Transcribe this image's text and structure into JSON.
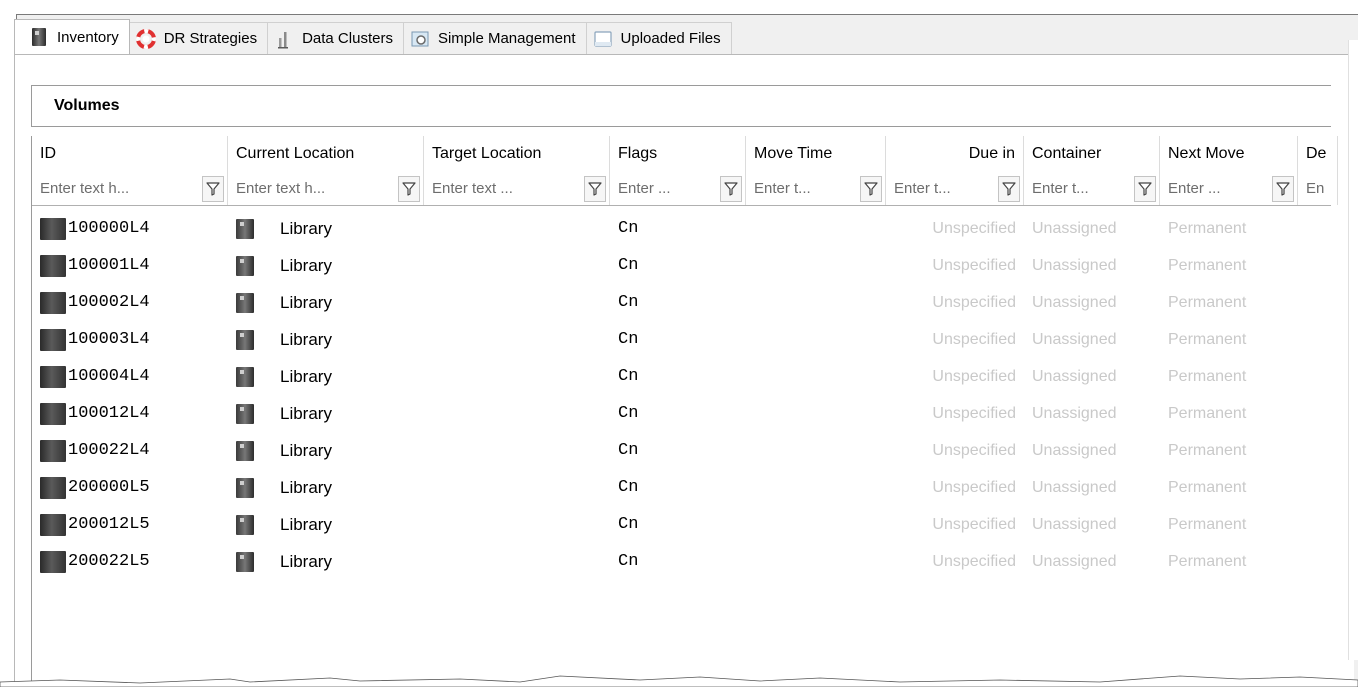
{
  "tabs": [
    {
      "label": "Inventory",
      "icon": "volume-icon",
      "active": true
    },
    {
      "label": "DR Strategies",
      "icon": "lifebuoy-icon",
      "active": false
    },
    {
      "label": "Data Clusters",
      "icon": "data-clusters-icon",
      "active": false
    },
    {
      "label": "Simple Management",
      "icon": "simple-management-icon",
      "active": false
    },
    {
      "label": "Uploaded Files",
      "icon": "uploaded-files-icon",
      "active": false
    }
  ],
  "group": {
    "title": "Volumes"
  },
  "grid": {
    "columns": [
      {
        "label": "ID",
        "filter_placeholder": "Enter text h..."
      },
      {
        "label": "Current Location",
        "filter_placeholder": "Enter text h..."
      },
      {
        "label": "Target Location",
        "filter_placeholder": "Enter text ..."
      },
      {
        "label": "Flags",
        "filter_placeholder": "Enter ..."
      },
      {
        "label": "Move Time",
        "filter_placeholder": "Enter t..."
      },
      {
        "label": "Due in",
        "filter_placeholder": "Enter t..."
      },
      {
        "label": "Container",
        "filter_placeholder": "Enter t..."
      },
      {
        "label": "Next Move",
        "filter_placeholder": "Enter ..."
      },
      {
        "label": "De",
        "filter_placeholder": "En"
      }
    ],
    "rows": [
      {
        "id": "100000L4",
        "current_location": "Library",
        "target_location": "",
        "flags": "Cn",
        "move_time": "",
        "due_in": "Unspecified",
        "container": "Unassigned",
        "next_move": "Permanent"
      },
      {
        "id": "100001L4",
        "current_location": "Library",
        "target_location": "",
        "flags": "Cn",
        "move_time": "",
        "due_in": "Unspecified",
        "container": "Unassigned",
        "next_move": "Permanent"
      },
      {
        "id": "100002L4",
        "current_location": "Library",
        "target_location": "",
        "flags": "Cn",
        "move_time": "",
        "due_in": "Unspecified",
        "container": "Unassigned",
        "next_move": "Permanent"
      },
      {
        "id": "100003L4",
        "current_location": "Library",
        "target_location": "",
        "flags": "Cn",
        "move_time": "",
        "due_in": "Unspecified",
        "container": "Unassigned",
        "next_move": "Permanent"
      },
      {
        "id": "100004L4",
        "current_location": "Library",
        "target_location": "",
        "flags": "Cn",
        "move_time": "",
        "due_in": "Unspecified",
        "container": "Unassigned",
        "next_move": "Permanent"
      },
      {
        "id": "100012L4",
        "current_location": "Library",
        "target_location": "",
        "flags": "Cn",
        "move_time": "",
        "due_in": "Unspecified",
        "container": "Unassigned",
        "next_move": "Permanent"
      },
      {
        "id": "100022L4",
        "current_location": "Library",
        "target_location": "",
        "flags": "Cn",
        "move_time": "",
        "due_in": "Unspecified",
        "container": "Unassigned",
        "next_move": "Permanent"
      },
      {
        "id": "200000L5",
        "current_location": "Library",
        "target_location": "",
        "flags": "Cn",
        "move_time": "",
        "due_in": "Unspecified",
        "container": "Unassigned",
        "next_move": "Permanent"
      },
      {
        "id": "200012L5",
        "current_location": "Library",
        "target_location": "",
        "flags": "Cn",
        "move_time": "",
        "due_in": "Unspecified",
        "container": "Unassigned",
        "next_move": "Permanent"
      },
      {
        "id": "200022L5",
        "current_location": "Library",
        "target_location": "",
        "flags": "Cn",
        "move_time": "",
        "due_in": "Unspecified",
        "container": "Unassigned",
        "next_move": "Permanent"
      }
    ]
  },
  "colors": {
    "faded_text": "#c9c9c9",
    "placeholder_text": "#6d6d6d",
    "lifebuoy_red": "#e03030",
    "border": "#9a9a9a"
  }
}
